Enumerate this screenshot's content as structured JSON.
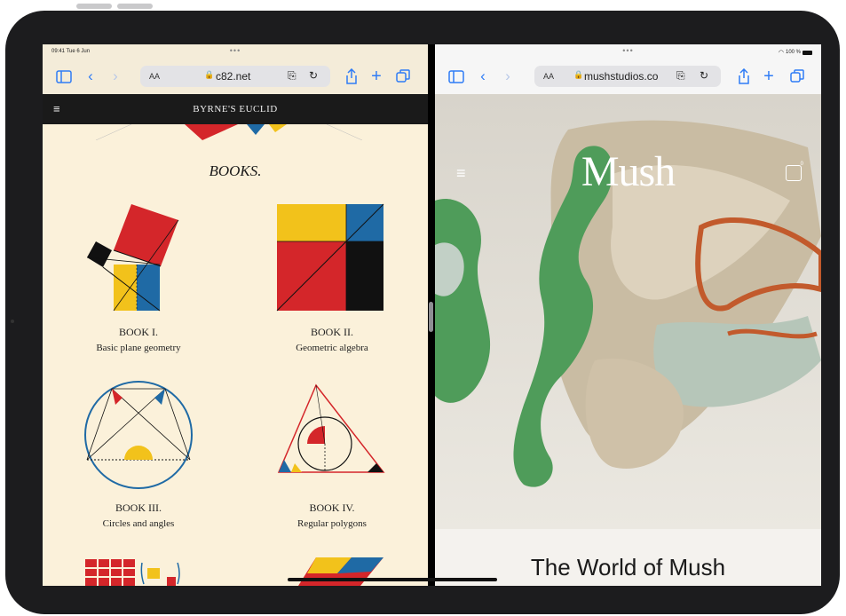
{
  "left_pane": {
    "status": {
      "time": "09:41 Tue 6 Jun"
    },
    "toolbar": {
      "text_size_label": "AA",
      "url": "c82.net",
      "lock_icon": "lock-icon",
      "reader_icon": "reader-icon",
      "reload_icon": "reload-icon"
    },
    "site": {
      "title": "BYRNE'S EUCLID",
      "heading": "BOOKS."
    },
    "books": [
      {
        "name": "BOOK I.",
        "subtitle": "Basic plane geometry"
      },
      {
        "name": "BOOK II.",
        "subtitle": "Geometric algebra"
      },
      {
        "name": "BOOK III.",
        "subtitle": "Circles and angles"
      },
      {
        "name": "BOOK IV.",
        "subtitle": "Regular polygons"
      }
    ]
  },
  "right_pane": {
    "status": {
      "battery": "100 %"
    },
    "toolbar": {
      "text_size_label": "AA",
      "url": "mushstudios.co"
    },
    "site": {
      "logo": "Mush",
      "cart_count": "0",
      "title": "The World of Mush"
    }
  },
  "colors": {
    "safari_blue": "#2f7cf6",
    "euclid_red": "#d4262a",
    "euclid_yellow": "#f2c21b",
    "euclid_blue": "#1f6aa5",
    "euclid_cream": "#fbf1da"
  }
}
